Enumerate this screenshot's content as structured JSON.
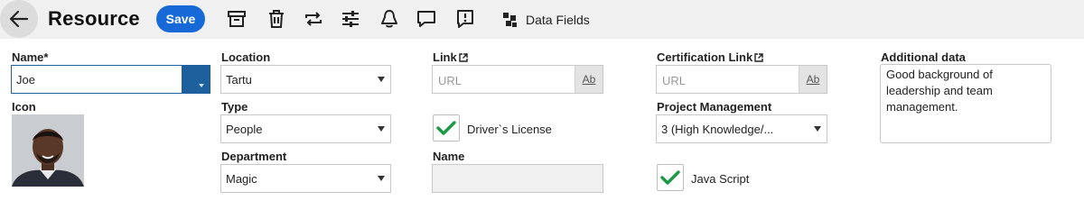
{
  "header": {
    "title": "Resource",
    "save_label": "Save",
    "data_fields_label": "Data Fields",
    "icons": [
      "back-arrow-icon",
      "archive-icon",
      "trash-icon",
      "repeat-icon",
      "sliders-icon",
      "bell-icon",
      "comment-icon",
      "report-icon",
      "data-fields-icon"
    ]
  },
  "form": {
    "name": {
      "label": "Name*",
      "value": "Joe"
    },
    "icon": {
      "label": "Icon"
    },
    "location": {
      "label": "Location",
      "value": "Tartu"
    },
    "type": {
      "label": "Type",
      "value": "People"
    },
    "department": {
      "label": "Department",
      "value": "Magic"
    },
    "link": {
      "label": "Link",
      "placeholder": "URL",
      "ab": "Ab"
    },
    "drivers_license": {
      "label": "Driver`s License",
      "checked": true
    },
    "name2": {
      "label": "Name",
      "value": ""
    },
    "certification_link": {
      "label": "Certification Link",
      "placeholder": "URL",
      "ab": "Ab"
    },
    "project_management": {
      "label": "Project Management",
      "value": "3 (High Knowledge/..."
    },
    "java_script": {
      "label": "Java Script",
      "checked": true
    },
    "additional_data": {
      "label": "Additional data",
      "value": "Good background of leadership and team management."
    }
  },
  "colors": {
    "accent": "#1769d8",
    "toolbar_bg": "#f0f0f0",
    "check_green": "#1a9a44",
    "name_dropdown": "#1e5f9e"
  }
}
